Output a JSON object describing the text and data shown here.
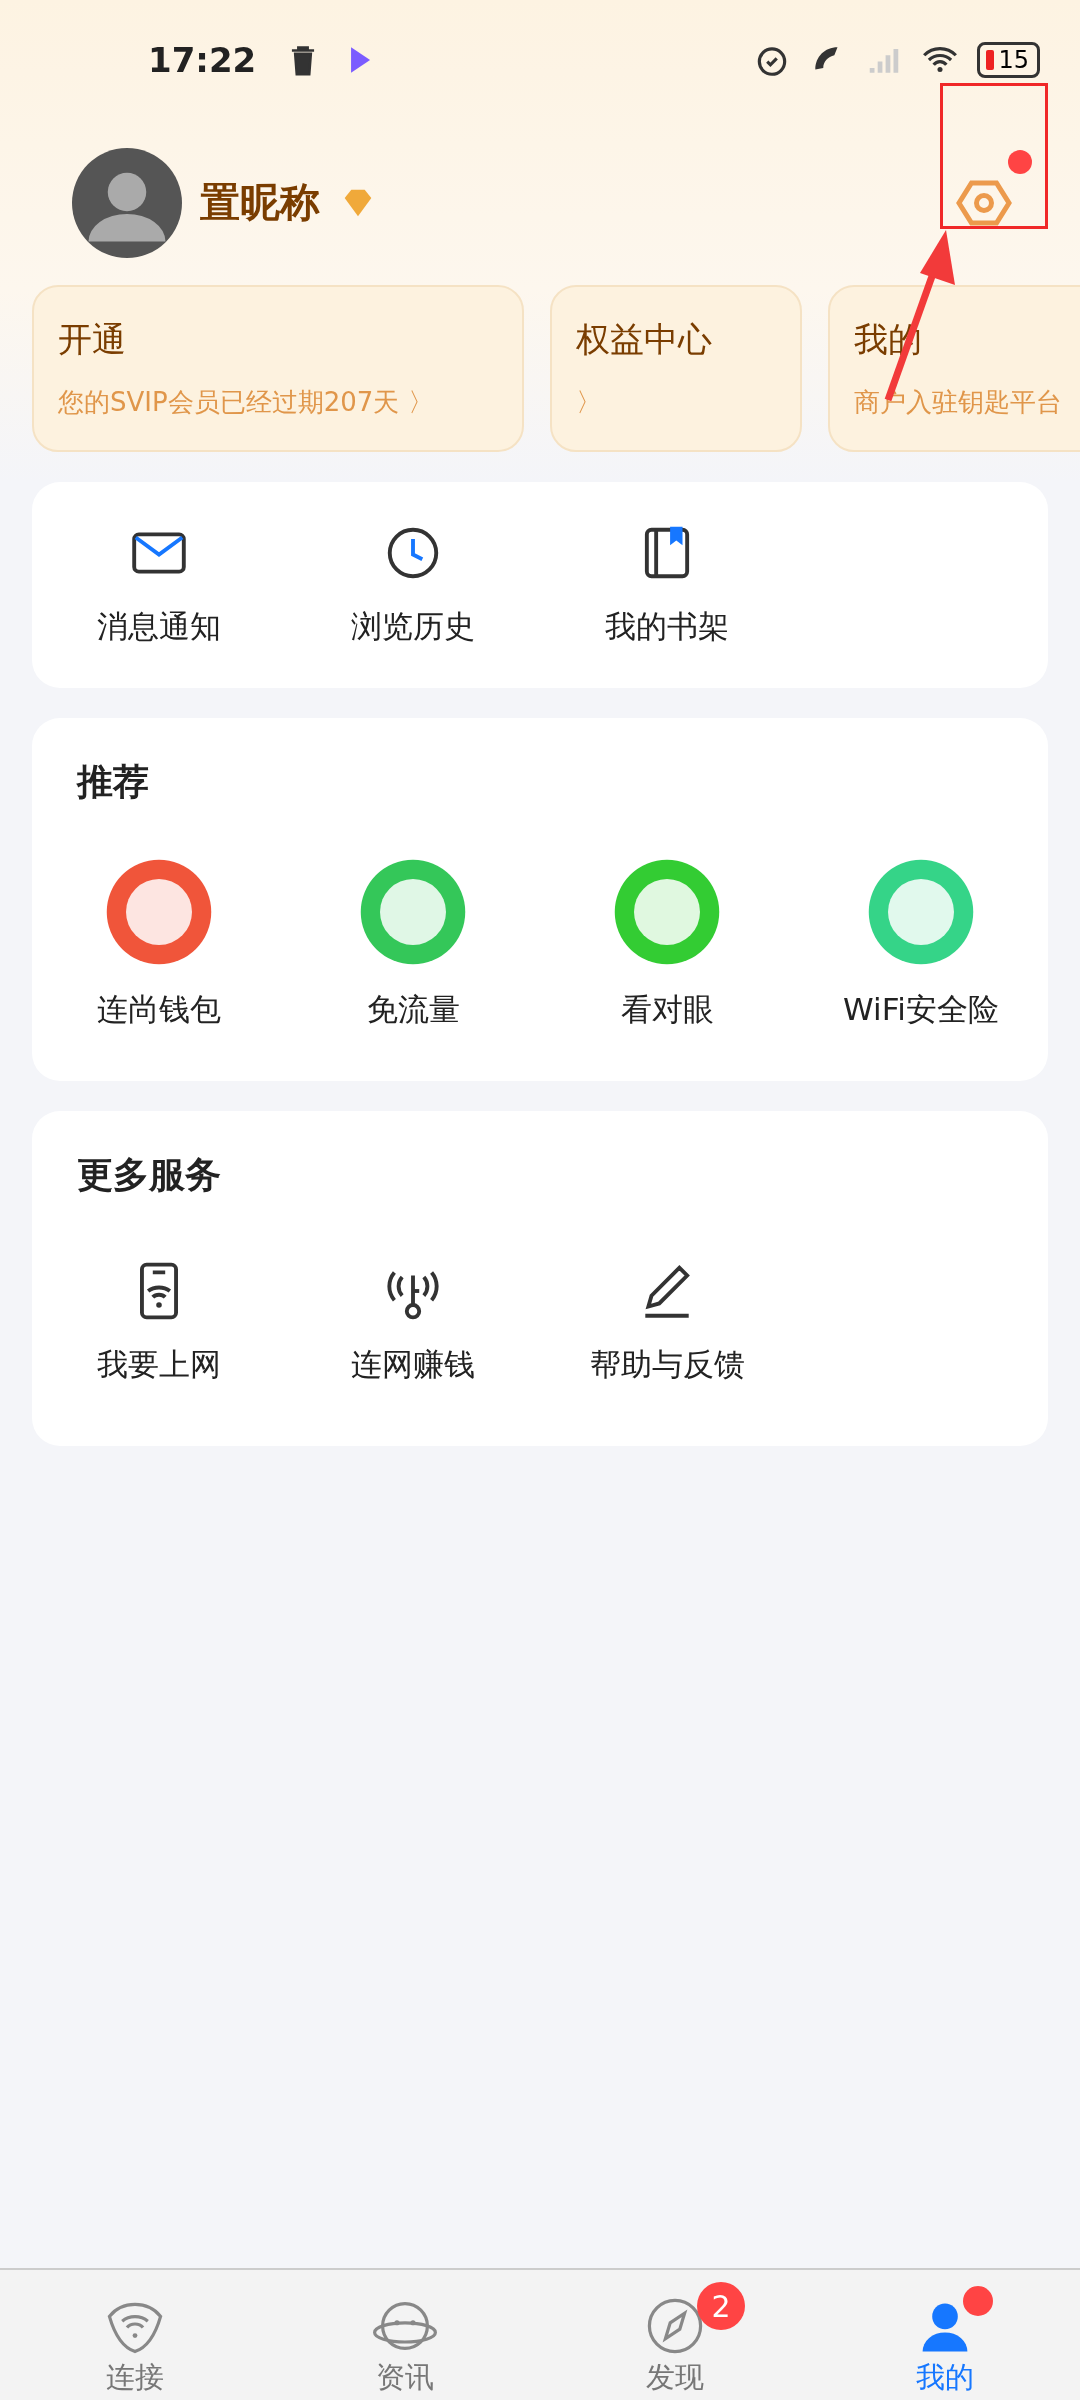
{
  "status_bar": {
    "time": "17:22",
    "battery": "15"
  },
  "profile": {
    "nickname": "置昵称"
  },
  "member_cards": [
    {
      "title": "开通",
      "subtitle": "您的SVIP会员已经过期207天 〉"
    },
    {
      "title": "权益中心",
      "subtitle": "〉"
    },
    {
      "title": "我的",
      "subtitle": "商户入驻钥匙平台"
    }
  ],
  "shortcuts": [
    {
      "label": "消息通知",
      "kind": "mail"
    },
    {
      "label": "浏览历史",
      "kind": "clock"
    },
    {
      "label": "我的书架",
      "kind": "book"
    }
  ],
  "recommend": {
    "title": "推荐",
    "items": [
      {
        "label": "连尚钱包",
        "color": "#f0553a"
      },
      {
        "label": "免流量",
        "color": "#34c759"
      },
      {
        "label": "看对眼",
        "color": "#33cc33"
      },
      {
        "label": "WiFi安全险",
        "color": "#35d488"
      }
    ]
  },
  "services": {
    "title": "更多服务",
    "items": [
      {
        "label": "我要上网",
        "kind": "phone-wifi"
      },
      {
        "label": "连网赚钱",
        "kind": "key-signal"
      },
      {
        "label": "帮助与反馈",
        "kind": "pencil"
      }
    ]
  },
  "tabs": [
    {
      "label": "连接",
      "kind": "wifi",
      "selected": false
    },
    {
      "label": "资讯",
      "kind": "planet",
      "selected": false
    },
    {
      "label": "发现",
      "kind": "compass",
      "selected": false,
      "badge": "2"
    },
    {
      "label": "我的",
      "kind": "me",
      "selected": true,
      "dot": true
    }
  ]
}
